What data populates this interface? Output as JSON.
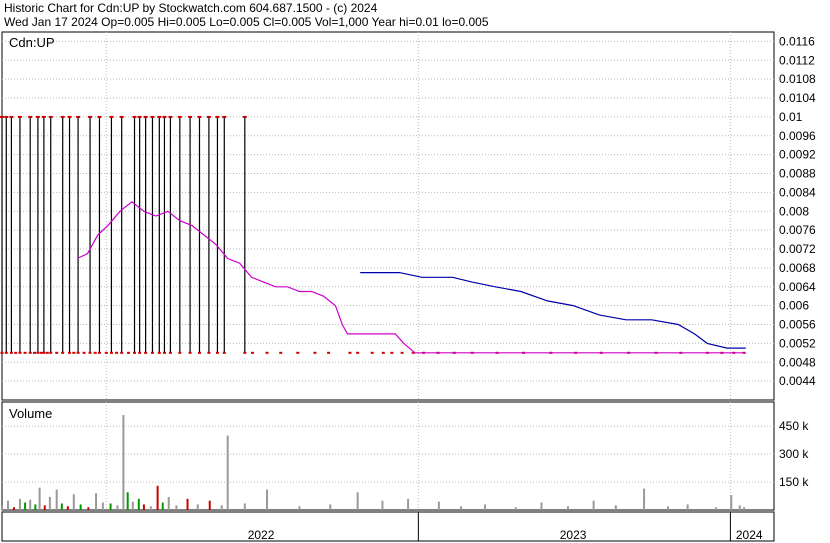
{
  "header": {
    "line1": "Historic Chart for Cdn:UP by Stockwatch.com 604.687.1500 - (c) 2024",
    "line2": "Wed Jan 17 2024   Op=0.005  Hi=0.005  Lo=0.005  Cl=0.005  Vol=1,000  Year hi=0.01  lo=0.005"
  },
  "chart_data": {
    "type": "line",
    "symbol_label": "Cdn:UP",
    "volume_label": "Volume",
    "price_axis": {
      "ylim": [
        0.004,
        0.0118
      ],
      "ticks": [
        0.0116,
        0.0112,
        0.0108,
        0.0104,
        0.01,
        0.0096,
        0.0092,
        0.0088,
        0.0084,
        0.008,
        0.0076,
        0.0072,
        0.0068,
        0.0064,
        0.006,
        0.0056,
        0.0052,
        0.0048,
        0.0044
      ],
      "tick_labels": [
        "0.0116",
        "0.0112",
        "0.0108",
        "0.0104",
        "0.01",
        "0.0096",
        "0.0092",
        "0.0088",
        "0.0084",
        "0.008",
        "0.0076",
        "0.0072",
        "0.0068",
        "0.0064",
        "0.006",
        "0.0056",
        "0.0052",
        "0.0048",
        "0.0044"
      ]
    },
    "volume_axis": {
      "ylim": [
        0,
        580000
      ],
      "ticks": [
        450000,
        300000,
        150000
      ],
      "tick_labels": [
        "450 k",
        "300 k",
        "150 k"
      ]
    },
    "time_axis": {
      "start": "2021-09-01",
      "end": "2024-02-21",
      "year_boundaries": [
        "2022-01-01",
        "2023-01-01",
        "2024-01-01"
      ],
      "year_labels": [
        {
          "label": "2022",
          "center": "2022-07-01"
        },
        {
          "label": "2023",
          "center": "2023-07-01"
        },
        {
          "label": "2024",
          "center": "2024-01-23"
        }
      ]
    },
    "price_bars": [
      {
        "date": "2021-09-01",
        "high": 0.01,
        "low": 0.005
      },
      {
        "date": "2021-09-06",
        "high": 0.01,
        "low": 0.005
      },
      {
        "date": "2021-09-12",
        "high": 0.01,
        "low": 0.005
      },
      {
        "date": "2021-09-22",
        "high": 0.01,
        "low": 0.005
      },
      {
        "date": "2021-10-04",
        "high": 0.01,
        "low": 0.005
      },
      {
        "date": "2021-10-13",
        "high": 0.01,
        "low": 0.005
      },
      {
        "date": "2021-10-20",
        "high": 0.01,
        "low": 0.005
      },
      {
        "date": "2021-10-28",
        "high": 0.01,
        "low": 0.005
      },
      {
        "date": "2021-11-11",
        "high": 0.01,
        "low": 0.005
      },
      {
        "date": "2021-11-19",
        "high": 0.01,
        "low": 0.005
      },
      {
        "date": "2021-11-29",
        "high": 0.01,
        "low": 0.005
      },
      {
        "date": "2021-12-13",
        "high": 0.01,
        "low": 0.005
      },
      {
        "date": "2021-12-24",
        "high": 0.01,
        "low": 0.005
      },
      {
        "date": "2022-01-07",
        "high": 0.01,
        "low": 0.005
      },
      {
        "date": "2022-01-19",
        "high": 0.01,
        "low": 0.005
      },
      {
        "date": "2022-02-03",
        "high": 0.01,
        "low": 0.005
      },
      {
        "date": "2022-02-09",
        "high": 0.01,
        "low": 0.005
      },
      {
        "date": "2022-02-16",
        "high": 0.01,
        "low": 0.005
      },
      {
        "date": "2022-02-24",
        "high": 0.01,
        "low": 0.005
      },
      {
        "date": "2022-03-04",
        "high": 0.01,
        "low": 0.005
      },
      {
        "date": "2022-03-10",
        "high": 0.01,
        "low": 0.005
      },
      {
        "date": "2022-03-17",
        "high": 0.01,
        "low": 0.005
      },
      {
        "date": "2022-03-28",
        "high": 0.01,
        "low": 0.005
      },
      {
        "date": "2022-04-09",
        "high": 0.01,
        "low": 0.005
      },
      {
        "date": "2022-04-20",
        "high": 0.01,
        "low": 0.005
      },
      {
        "date": "2022-05-01",
        "high": 0.01,
        "low": 0.005
      },
      {
        "date": "2022-05-11",
        "high": 0.01,
        "low": 0.005
      },
      {
        "date": "2022-05-19",
        "high": 0.01,
        "low": 0.005
      },
      {
        "date": "2022-06-12",
        "high": 0.01,
        "low": 0.005
      }
    ],
    "close_dates": [
      "2021-09-01",
      "2021-09-06",
      "2021-09-12",
      "2021-09-17",
      "2021-09-22",
      "2021-09-28",
      "2021-10-04",
      "2021-10-09",
      "2021-10-13",
      "2021-10-17",
      "2021-10-20",
      "2021-10-24",
      "2021-10-28",
      "2021-11-04",
      "2021-11-11",
      "2021-11-19",
      "2021-11-24",
      "2021-11-29",
      "2021-12-06",
      "2021-12-13",
      "2021-12-19",
      "2021-12-24",
      "2022-01-01",
      "2022-01-07",
      "2022-01-13",
      "2022-01-19",
      "2022-01-27",
      "2022-02-03",
      "2022-02-09",
      "2022-02-16",
      "2022-02-24",
      "2022-03-04",
      "2022-03-10",
      "2022-03-17",
      "2022-03-28",
      "2022-04-09",
      "2022-04-20",
      "2022-05-01",
      "2022-05-11",
      "2022-05-19",
      "2022-06-12",
      "2022-06-21",
      "2022-07-08",
      "2022-07-24",
      "2022-08-13",
      "2022-09-02",
      "2022-09-18",
      "2022-10-13",
      "2022-10-22",
      "2022-11-08",
      "2022-11-21",
      "2022-12-01",
      "2022-12-13",
      "2022-12-26",
      "2023-01-07",
      "2023-01-24",
      "2023-02-12",
      "2023-03-05",
      "2023-04-03",
      "2023-05-04",
      "2023-06-05",
      "2023-07-04",
      "2023-08-03",
      "2023-09-04",
      "2023-10-06",
      "2023-11-04",
      "2023-12-05",
      "2023-12-22",
      "2024-01-05",
      "2024-01-17"
    ],
    "close_value": 0.005,
    "series": [
      {
        "color": "#cc00cc",
        "points": [
          [
            "2021-11-28",
            0.007
          ],
          [
            "2021-12-10",
            0.0071
          ],
          [
            "2021-12-22",
            0.0075
          ],
          [
            "2022-01-03",
            0.0077
          ],
          [
            "2022-01-17",
            0.008
          ],
          [
            "2022-01-31",
            0.0082
          ],
          [
            "2022-02-14",
            0.008
          ],
          [
            "2022-02-28",
            0.0079
          ],
          [
            "2022-03-14",
            0.008
          ],
          [
            "2022-03-28",
            0.0078
          ],
          [
            "2022-04-11",
            0.0077
          ],
          [
            "2022-04-25",
            0.0075
          ],
          [
            "2022-05-09",
            0.0073
          ],
          [
            "2022-05-23",
            0.007
          ],
          [
            "2022-06-06",
            0.0069
          ],
          [
            "2022-06-20",
            0.0066
          ],
          [
            "2022-07-04",
            0.0065
          ],
          [
            "2022-07-18",
            0.0064
          ],
          [
            "2022-08-01",
            0.0064
          ],
          [
            "2022-08-15",
            0.0063
          ],
          [
            "2022-08-29",
            0.0063
          ],
          [
            "2022-09-12",
            0.0062
          ],
          [
            "2022-09-26",
            0.006
          ],
          [
            "2022-10-04",
            0.0056
          ],
          [
            "2022-10-10",
            0.0054
          ],
          [
            "2022-11-07",
            0.0054
          ],
          [
            "2022-12-05",
            0.0054
          ],
          [
            "2022-12-15",
            0.0052
          ],
          [
            "2022-12-28",
            0.005
          ],
          [
            "2023-06-01",
            0.005
          ],
          [
            "2023-12-01",
            0.005
          ],
          [
            "2024-01-19",
            0.005
          ]
        ]
      },
      {
        "color": "#0000aa",
        "points": [
          [
            "2022-10-25",
            0.0067
          ],
          [
            "2022-12-10",
            0.0067
          ],
          [
            "2023-01-05",
            0.0066
          ],
          [
            "2023-02-10",
            0.0066
          ],
          [
            "2023-03-05",
            0.0065
          ],
          [
            "2023-04-01",
            0.0064
          ],
          [
            "2023-05-01",
            0.0063
          ],
          [
            "2023-06-01",
            0.0061
          ],
          [
            "2023-07-01",
            0.006
          ],
          [
            "2023-08-01",
            0.0058
          ],
          [
            "2023-09-01",
            0.0057
          ],
          [
            "2023-10-01",
            0.0057
          ],
          [
            "2023-11-01",
            0.0056
          ],
          [
            "2023-11-20",
            0.0054
          ],
          [
            "2023-12-05",
            0.0052
          ],
          [
            "2023-12-28",
            0.0051
          ],
          [
            "2024-01-19",
            0.0051
          ]
        ]
      }
    ],
    "volume_bars": [
      {
        "date": "2021-09-01",
        "value": 20000,
        "color": "#999999"
      },
      {
        "date": "2021-09-08",
        "value": 50000,
        "color": "#999999"
      },
      {
        "date": "2021-09-15",
        "value": 15000,
        "color": "#cc0000"
      },
      {
        "date": "2021-09-22",
        "value": 60000,
        "color": "#999999"
      },
      {
        "date": "2021-09-28",
        "value": 40000,
        "color": "#009900"
      },
      {
        "date": "2021-10-04",
        "value": 55000,
        "color": "#999999"
      },
      {
        "date": "2021-10-10",
        "value": 30000,
        "color": "#009900"
      },
      {
        "date": "2021-10-15",
        "value": 120000,
        "color": "#999999"
      },
      {
        "date": "2021-10-21",
        "value": 25000,
        "color": "#cc0000"
      },
      {
        "date": "2021-10-27",
        "value": 70000,
        "color": "#999999"
      },
      {
        "date": "2021-11-04",
        "value": 110000,
        "color": "#999999"
      },
      {
        "date": "2021-11-10",
        "value": 35000,
        "color": "#009900"
      },
      {
        "date": "2021-11-17",
        "value": 20000,
        "color": "#cc0000"
      },
      {
        "date": "2021-11-24",
        "value": 85000,
        "color": "#999999"
      },
      {
        "date": "2021-12-02",
        "value": 30000,
        "color": "#009900"
      },
      {
        "date": "2021-12-11",
        "value": 15000,
        "color": "#cc0000"
      },
      {
        "date": "2021-12-20",
        "value": 90000,
        "color": "#999999"
      },
      {
        "date": "2021-12-28",
        "value": 40000,
        "color": "#999999"
      },
      {
        "date": "2022-01-06",
        "value": 35000,
        "color": "#009900"
      },
      {
        "date": "2022-01-14",
        "value": 25000,
        "color": "#999999"
      },
      {
        "date": "2022-01-21",
        "value": 510000,
        "color": "#999999"
      },
      {
        "date": "2022-01-26",
        "value": 95000,
        "color": "#009900"
      },
      {
        "date": "2022-02-01",
        "value": 45000,
        "color": "#999999"
      },
      {
        "date": "2022-02-08",
        "value": 60000,
        "color": "#009900"
      },
      {
        "date": "2022-02-14",
        "value": 30000,
        "color": "#cc0000"
      },
      {
        "date": "2022-02-22",
        "value": 20000,
        "color": "#999999"
      },
      {
        "date": "2022-03-02",
        "value": 130000,
        "color": "#cc0000"
      },
      {
        "date": "2022-03-08",
        "value": 40000,
        "color": "#009900"
      },
      {
        "date": "2022-03-15",
        "value": 70000,
        "color": "#999999"
      },
      {
        "date": "2022-03-24",
        "value": 25000,
        "color": "#999999"
      },
      {
        "date": "2022-04-06",
        "value": 60000,
        "color": "#cc0000"
      },
      {
        "date": "2022-04-18",
        "value": 30000,
        "color": "#999999"
      },
      {
        "date": "2022-05-02",
        "value": 50000,
        "color": "#cc0000"
      },
      {
        "date": "2022-05-16",
        "value": 25000,
        "color": "#999999"
      },
      {
        "date": "2022-05-23",
        "value": 400000,
        "color": "#999999"
      },
      {
        "date": "2022-06-12",
        "value": 35000,
        "color": "#999999"
      },
      {
        "date": "2022-07-08",
        "value": 110000,
        "color": "#999999"
      },
      {
        "date": "2022-08-15",
        "value": 20000,
        "color": "#999999"
      },
      {
        "date": "2022-09-20",
        "value": 30000,
        "color": "#999999"
      },
      {
        "date": "2022-10-22",
        "value": 95000,
        "color": "#999999"
      },
      {
        "date": "2022-11-20",
        "value": 50000,
        "color": "#999999"
      },
      {
        "date": "2022-12-20",
        "value": 60000,
        "color": "#999999"
      },
      {
        "date": "2023-01-25",
        "value": 45000,
        "color": "#999999"
      },
      {
        "date": "2023-02-20",
        "value": 20000,
        "color": "#999999"
      },
      {
        "date": "2023-03-20",
        "value": 30000,
        "color": "#999999"
      },
      {
        "date": "2023-04-25",
        "value": 15000,
        "color": "#999999"
      },
      {
        "date": "2023-05-25",
        "value": 40000,
        "color": "#999999"
      },
      {
        "date": "2023-06-25",
        "value": 20000,
        "color": "#999999"
      },
      {
        "date": "2023-07-25",
        "value": 50000,
        "color": "#999999"
      },
      {
        "date": "2023-08-20",
        "value": 25000,
        "color": "#999999"
      },
      {
        "date": "2023-09-22",
        "value": 115000,
        "color": "#999999"
      },
      {
        "date": "2023-10-20",
        "value": 20000,
        "color": "#999999"
      },
      {
        "date": "2023-11-12",
        "value": 30000,
        "color": "#999999"
      },
      {
        "date": "2023-12-15",
        "value": 15000,
        "color": "#999999"
      },
      {
        "date": "2024-01-02",
        "value": 80000,
        "color": "#999999"
      },
      {
        "date": "2024-01-12",
        "value": 25000,
        "color": "#999999"
      },
      {
        "date": "2024-01-17",
        "value": 15000,
        "color": "#999999"
      }
    ]
  }
}
